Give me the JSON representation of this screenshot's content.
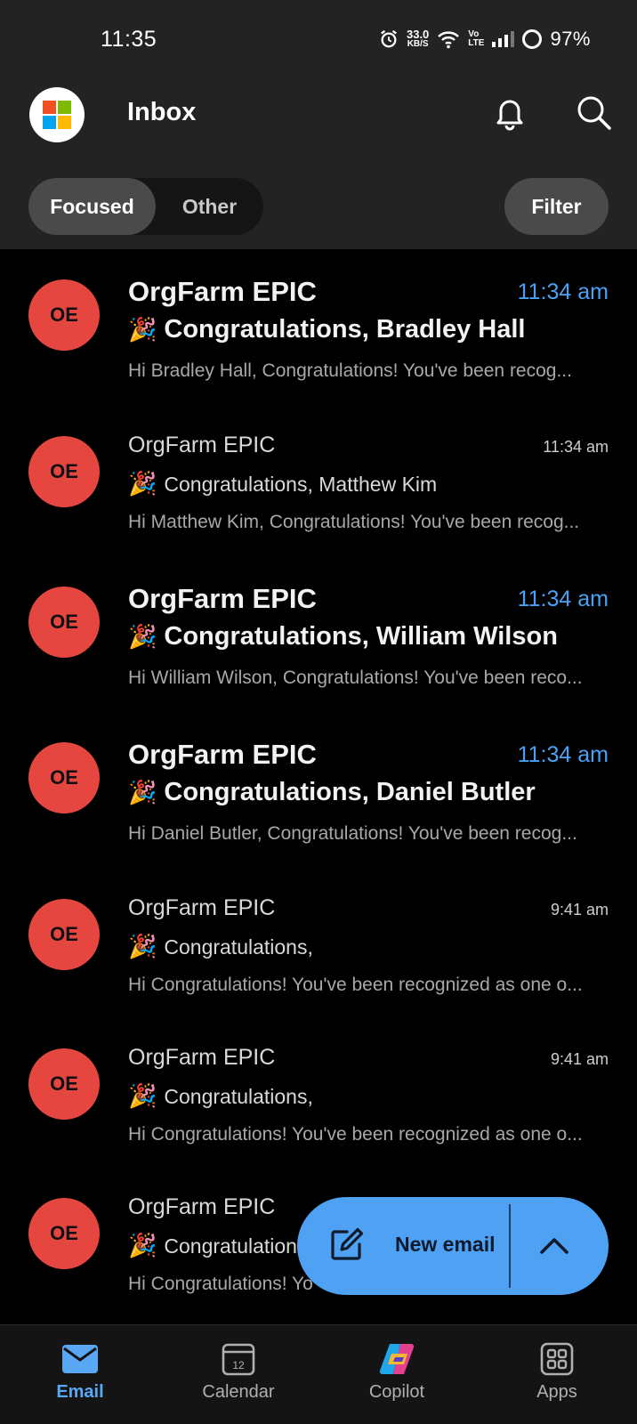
{
  "status_bar": {
    "time": "11:35",
    "speed_value": "33.0",
    "speed_unit": "KB/S",
    "volte_top": "Vo",
    "volte_bottom": "LTE",
    "battery": "97%"
  },
  "header": {
    "title": "Inbox",
    "icons": [
      "microsoft-logo",
      "bell-icon",
      "search-icon"
    ]
  },
  "tabs": {
    "focused_label": "Focused",
    "other_label": "Other",
    "filter_label": "Filter"
  },
  "emails": [
    {
      "avatar": "OE",
      "sender": "OrgFarm EPIC",
      "time": "11:34 am",
      "subject": "Congratulations, Bradley Hall",
      "preview": "Hi Bradley Hall, Congratulations! You've been recog...",
      "unread": true
    },
    {
      "avatar": "OE",
      "sender": "OrgFarm EPIC",
      "time": "11:34 am",
      "subject": "Congratulations, Matthew Kim",
      "preview": "Hi Matthew Kim, Congratulations! You've been recog...",
      "unread": false
    },
    {
      "avatar": "OE",
      "sender": "OrgFarm EPIC",
      "time": "11:34 am",
      "subject": "Congratulations, William Wilson",
      "preview": "Hi William Wilson, Congratulations! You've been reco...",
      "unread": true
    },
    {
      "avatar": "OE",
      "sender": "OrgFarm EPIC",
      "time": "11:34 am",
      "subject": "Congratulations, Daniel Butler",
      "preview": "Hi Daniel Butler, Congratulations! You've been recog...",
      "unread": true
    },
    {
      "avatar": "OE",
      "sender": "OrgFarm EPIC",
      "time": "9:41 am",
      "subject": "Congratulations,",
      "preview": "Hi Congratulations! You've been recognized as one o...",
      "unread": false
    },
    {
      "avatar": "OE",
      "sender": "OrgFarm EPIC",
      "time": "9:41 am",
      "subject": "Congratulations,",
      "preview": "Hi Congratulations! You've been recognized as one o...",
      "unread": false
    },
    {
      "avatar": "OE",
      "sender": "OrgFarm EPIC",
      "time": "",
      "subject": "Congratulation",
      "preview": "Hi Congratulations! Yo",
      "unread": false
    }
  ],
  "fab": {
    "label": "New email"
  },
  "bottom_nav": {
    "email": "Email",
    "calendar": "Calendar",
    "calendar_day": "12",
    "copilot": "Copilot",
    "apps": "Apps"
  },
  "colors": {
    "accent": "#4ea1f3",
    "avatar": "#e5463f",
    "unread_time": "#4aa2f6"
  }
}
